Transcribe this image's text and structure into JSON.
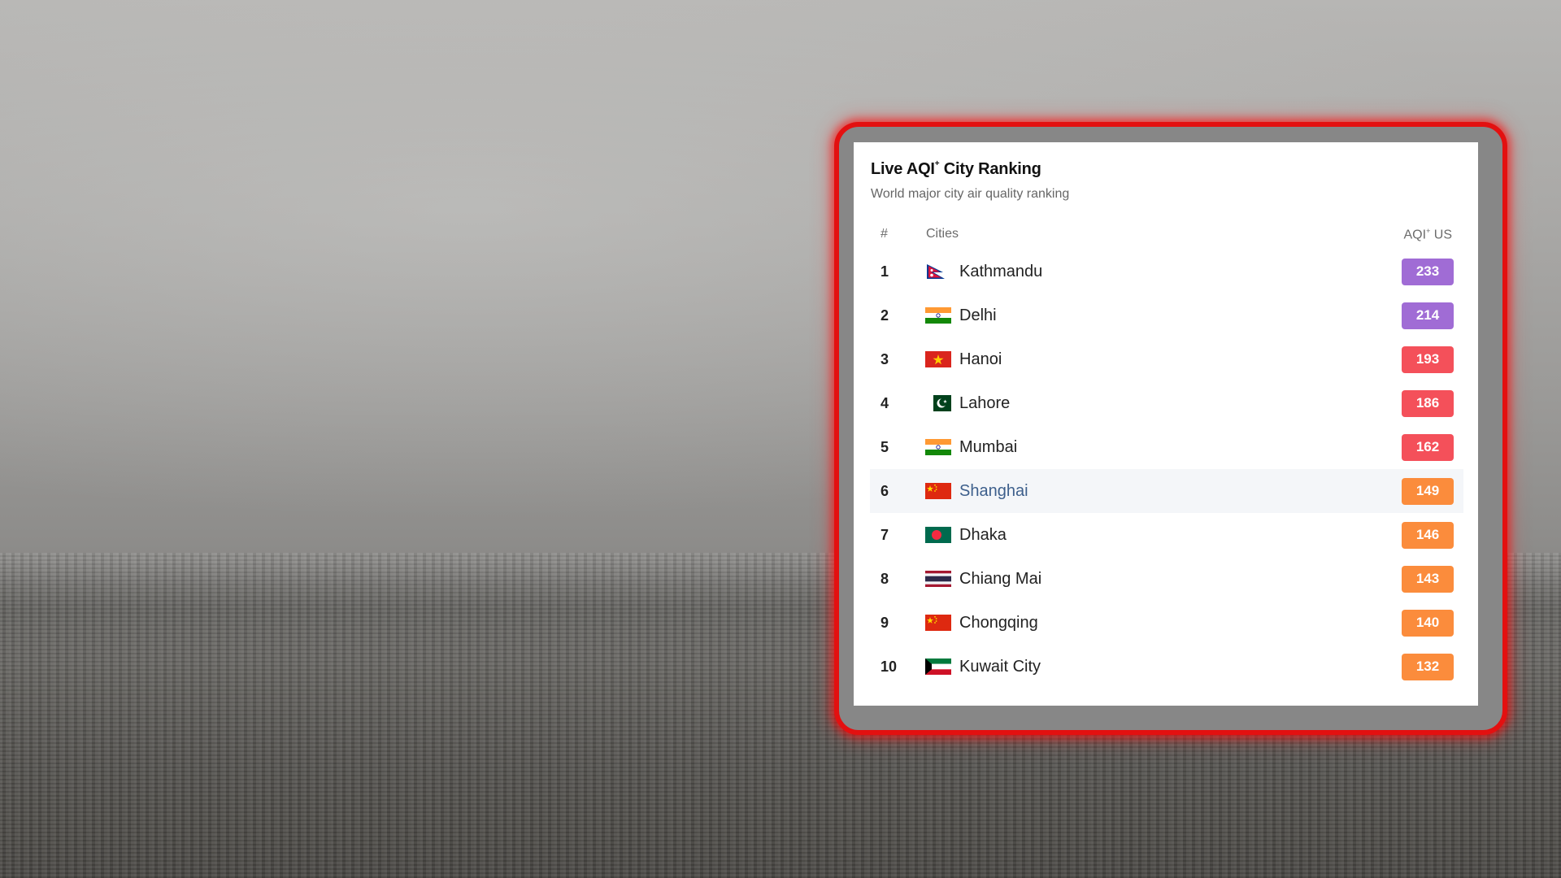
{
  "card": {
    "title": "Live AQI",
    "title_sup": "+",
    "title_suffix": " City Ranking",
    "subtitle": "World major city air quality ranking",
    "headers": {
      "num": "#",
      "city": "Cities",
      "aqi": "AQI",
      "aqi_sup": "+",
      "aqi_suffix": " US"
    }
  },
  "colors": {
    "very_unhealthy": "#a06cd5",
    "unhealthy": "#f4505a",
    "sensitive": "#fb8c3c",
    "frame": "#e31010"
  },
  "rows": [
    {
      "rank": "1",
      "city": "Kathmandu",
      "aqi": "233",
      "flag": "nepal-flag-icon",
      "level": "very_unhealthy"
    },
    {
      "rank": "2",
      "city": "Delhi",
      "aqi": "214",
      "flag": "india-flag-icon",
      "level": "very_unhealthy"
    },
    {
      "rank": "3",
      "city": "Hanoi",
      "aqi": "193",
      "flag": "vietnam-flag-icon",
      "level": "unhealthy"
    },
    {
      "rank": "4",
      "city": "Lahore",
      "aqi": "186",
      "flag": "pakistan-flag-icon",
      "level": "unhealthy"
    },
    {
      "rank": "5",
      "city": "Mumbai",
      "aqi": "162",
      "flag": "india-flag-icon",
      "level": "unhealthy"
    },
    {
      "rank": "6",
      "city": "Shanghai",
      "aqi": "149",
      "flag": "china-flag-icon",
      "level": "sensitive"
    },
    {
      "rank": "7",
      "city": "Dhaka",
      "aqi": "146",
      "flag": "bangladesh-flag-icon",
      "level": "sensitive"
    },
    {
      "rank": "8",
      "city": "Chiang Mai",
      "aqi": "143",
      "flag": "thailand-flag-icon",
      "level": "sensitive"
    },
    {
      "rank": "9",
      "city": "Chongqing",
      "aqi": "140",
      "flag": "china-flag-icon",
      "level": "sensitive"
    },
    {
      "rank": "10",
      "city": "Kuwait City",
      "aqi": "132",
      "flag": "kuwait-flag-icon",
      "level": "sensitive"
    }
  ]
}
